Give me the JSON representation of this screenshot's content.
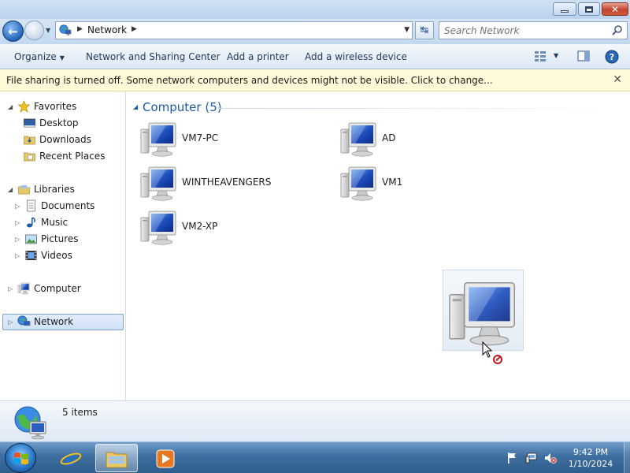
{
  "window": {
    "min_icon": "minimize-icon",
    "max_icon": "restore-icon",
    "close_icon": "close-icon",
    "close_glyph": "✕"
  },
  "address_bar": {
    "location": "Network",
    "search_placeholder": "Search Network"
  },
  "toolbar": {
    "organize": "Organize",
    "network_sharing_center": "Network and Sharing Center",
    "add_printer": "Add a printer",
    "add_wireless": "Add a wireless device"
  },
  "infobar": {
    "message": "File sharing is turned off. Some network computers and devices might not be visible. Click to change...",
    "close_glyph": "✕"
  },
  "navigation": {
    "favorites": "Favorites",
    "desktop": "Desktop",
    "downloads": "Downloads",
    "recent_places": "Recent Places",
    "libraries": "Libraries",
    "documents": "Documents",
    "music": "Music",
    "pictures": "Pictures",
    "videos": "Videos",
    "computer": "Computer",
    "network": "Network",
    "selected": "Network"
  },
  "content": {
    "group_title": "Computer (5)",
    "computers": [
      "VM7-PC",
      "AD",
      "WINTHEAVENGERS",
      "VM1",
      "VM2-XP"
    ]
  },
  "details": {
    "item_count": "5 items"
  },
  "taskbar": {
    "time": "9:42 PM",
    "date": "1/10/2024"
  },
  "colors": {
    "accent": "#1e5aa6",
    "infobar_bg": "#fffbd9",
    "selection": "#cfe1f7"
  }
}
